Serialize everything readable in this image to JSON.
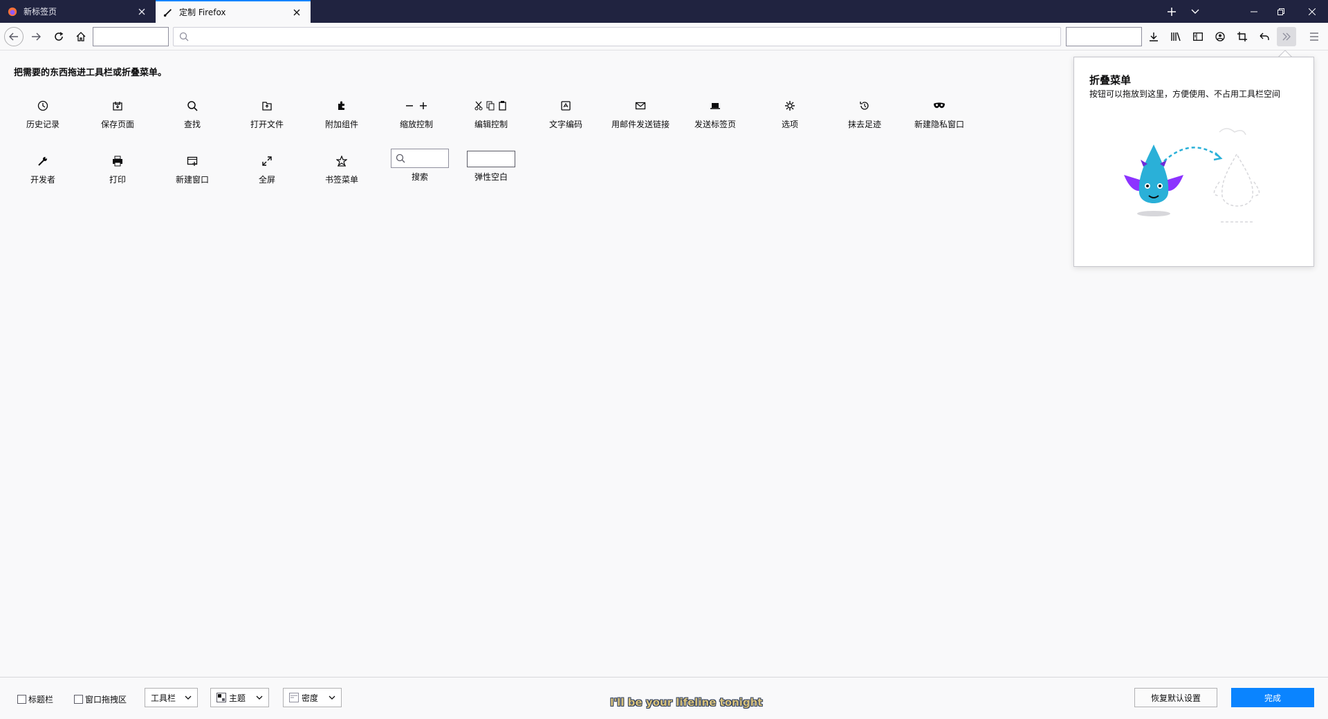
{
  "tabs": [
    {
      "label": "新标签页",
      "icon": "firefox-icon"
    },
    {
      "label": "定制 Firefox",
      "icon": "paintbrush-icon"
    }
  ],
  "window_controls": {
    "new_tab": "+",
    "list_all_tabs": "list-tabs-icon",
    "minimize": "minimize-icon",
    "restore": "restore-icon",
    "close": "close-icon"
  },
  "url_bar": {
    "placeholder": ""
  },
  "instructions": "把需要的东西拖进工具栏或折叠菜单。",
  "palette": {
    "row1": [
      "历史记录",
      "保存页面",
      "查找",
      "打开文件",
      "附加组件",
      "缩放控制",
      "编辑控制",
      "文字编码",
      "用邮件发送链接",
      "发送标签页",
      "选项",
      "抹去足迹",
      "新建隐私窗口"
    ],
    "row2": [
      "开发者",
      "打印",
      "新建窗口",
      "全屏",
      "书签菜单",
      "搜索",
      "弹性空白"
    ]
  },
  "overflow_panel": {
    "title": "折叠菜单",
    "description": "按钮可以拖放到这里，方便使用、不占用工具栏空间"
  },
  "footer": {
    "title_bar_label": "标题栏",
    "drag_space_label": "窗口拖拽区",
    "toolbars_label": "工具栏",
    "themes_label": "主题",
    "density_label": "密度",
    "restore_defaults_label": "恢复默认设置",
    "done_label": "完成"
  },
  "subtitle": "I'll be your lifeline tonight",
  "colors": {
    "accent": "#0a84ff",
    "tabbar": "#202340"
  }
}
